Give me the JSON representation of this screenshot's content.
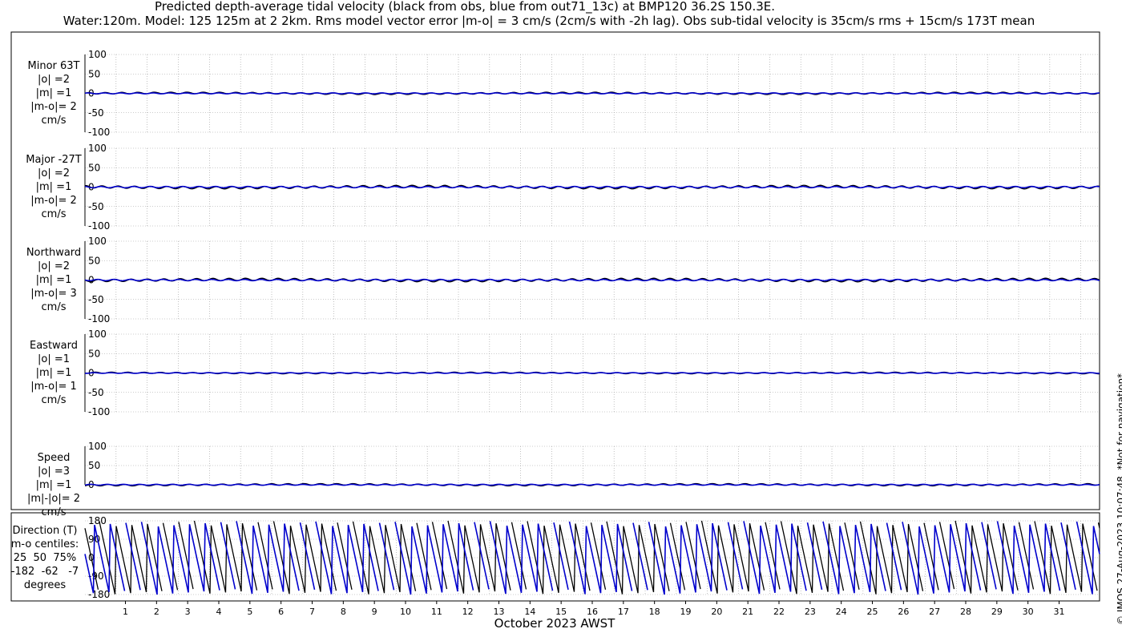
{
  "title_line1": "Predicted depth-average tidal velocity (black from obs, blue from out71_13c) at BMP120 36.2S 150.3E.",
  "title_line2": "Water:120m. Model: 125 125m at 2 2km. Rms model vector error |m-o| = 3 cm/s (2cm/s with -2h lag). Obs sub-tidal velocity is 35cm/s rms + 15cm/s 173T mean",
  "copyright": "© IMOS 27-Aug-2023 10:07:48. *Not for navigation*",
  "colors": {
    "obs": "#000000",
    "model": "#0000cc",
    "grid": "#999999"
  },
  "chart_data": {
    "type": "line",
    "xlabel": "October 2023 AWST",
    "x_ticks": [
      "1",
      "2",
      "3",
      "4",
      "5",
      "6",
      "7",
      "8",
      "9",
      "10",
      "11",
      "12",
      "13",
      "14",
      "15",
      "16",
      "17",
      "18",
      "19",
      "20",
      "21",
      "22",
      "23",
      "24",
      "25",
      "26",
      "27",
      "28",
      "29",
      "30",
      "31"
    ],
    "panels": [
      {
        "name": "minor",
        "label": [
          "Minor 63T",
          "|o| =2",
          "|m| =1",
          "|m-o|= 2",
          "cm/s"
        ],
        "ylim": [
          -100,
          100
        ],
        "yticks": [
          "100",
          "50",
          "0",
          "-50",
          "-100"
        ],
        "amp": 2
      },
      {
        "name": "major",
        "label": [
          "Major -27T",
          "|o| =2",
          "|m| =1",
          "|m-o|= 2",
          "cm/s"
        ],
        "ylim": [
          -100,
          100
        ],
        "yticks": [
          "100",
          "50",
          "0",
          "-50",
          "-100"
        ],
        "amp": 3
      },
      {
        "name": "northward",
        "label": [
          "Northward",
          "|o| =2",
          "|m| =1",
          "|m-o|= 3",
          "cm/s"
        ],
        "ylim": [
          -100,
          100
        ],
        "yticks": [
          "100",
          "50",
          "0",
          "-50",
          "-100"
        ],
        "amp": 3
      },
      {
        "name": "eastward",
        "label": [
          "Eastward",
          "|o| =1",
          "|m| =1",
          "|m-o|= 1",
          "cm/s"
        ],
        "ylim": [
          -100,
          100
        ],
        "yticks": [
          "100",
          "50",
          "0",
          "-50",
          "-100"
        ],
        "amp": 1.5
      },
      {
        "name": "speed",
        "label": [
          "Speed",
          "|o| =3",
          "|m| =1",
          "|m|-|o|= 2",
          "cm/s"
        ],
        "ylim": [
          0,
          100
        ],
        "yticks": [
          "100",
          "50",
          "0"
        ],
        "amp": 2
      }
    ],
    "direction_panel": {
      "label": [
        "Direction (T)",
        "m-o centiles:",
        "25  50  75%",
        "-182  -62   -7",
        "degrees"
      ],
      "ylim": [
        -180,
        180
      ],
      "yticks": [
        "180",
        "90",
        "0",
        "-90",
        "-180"
      ]
    },
    "series": [
      {
        "name": "obs"
      },
      {
        "name": "model"
      }
    ]
  }
}
